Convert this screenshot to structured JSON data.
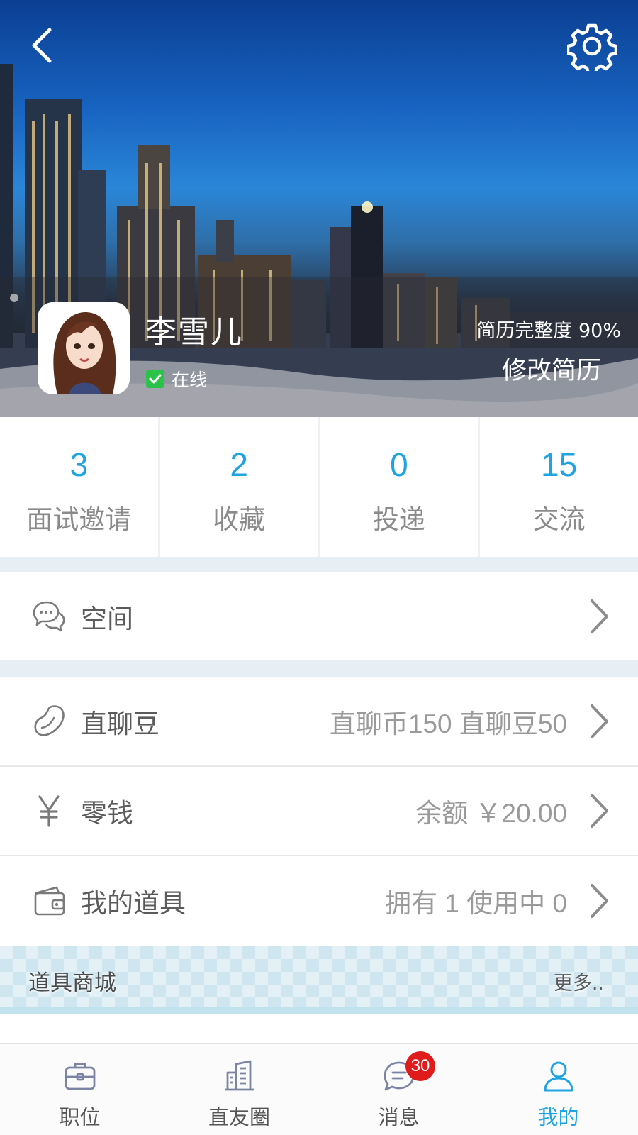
{
  "header": {
    "back_icon": "chevron-left-icon",
    "settings_icon": "gear-icon"
  },
  "profile": {
    "name": "李雪儿",
    "status": "在线",
    "status_color": "#2bc24a",
    "completeness": "简历完整度 90%",
    "edit_resume_label": "修改简历"
  },
  "stats": [
    {
      "value": "3",
      "label": "面试邀请"
    },
    {
      "value": "2",
      "label": "收藏"
    },
    {
      "value": "0",
      "label": "投递"
    },
    {
      "value": "15",
      "label": "交流"
    }
  ],
  "menu": {
    "space": {
      "icon": "chat-bubbles-icon",
      "label": "空间",
      "right": ""
    },
    "beans": {
      "icon": "bean-icon",
      "label": "直聊豆",
      "right": "直聊币150  直聊豆50"
    },
    "change": {
      "icon": "yuan-icon",
      "label": "零钱",
      "right": "余额 ￥20.00"
    },
    "props": {
      "icon": "wallet-icon",
      "label": "我的道具",
      "right": "拥有 1    使用中  0"
    }
  },
  "shop": {
    "title": "道具商城",
    "more": "更多.."
  },
  "tabbar": {
    "items": [
      {
        "icon": "briefcase-icon",
        "label": "职位",
        "active": false
      },
      {
        "icon": "building-icon",
        "label": "直友圈",
        "active": false
      },
      {
        "icon": "message-icon",
        "label": "消息",
        "active": false,
        "badge": "30"
      },
      {
        "icon": "user-icon",
        "label": "我的",
        "active": true
      }
    ]
  },
  "colors": {
    "accent": "#1fa3e3",
    "badge": "#e01b1b",
    "section_gap": "#e7eef4"
  }
}
